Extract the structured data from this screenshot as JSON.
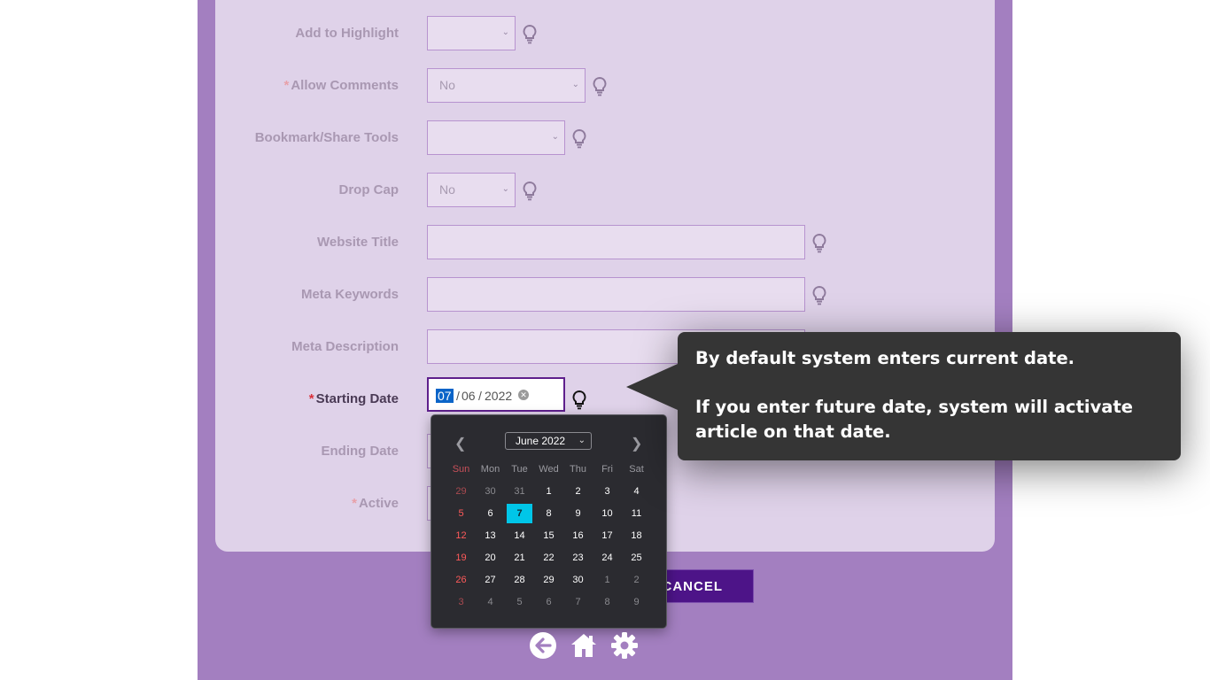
{
  "form": {
    "fields": [
      {
        "label": "Add to Highlight",
        "required": false,
        "value": ""
      },
      {
        "label": "Allow Comments",
        "required": true,
        "value": "No"
      },
      {
        "label": "Bookmark/Share Tools",
        "required": false,
        "value": ""
      },
      {
        "label": "Drop Cap",
        "required": false,
        "value": "No"
      },
      {
        "label": "Website Title",
        "required": false,
        "value": ""
      },
      {
        "label": "Meta Keywords",
        "required": false,
        "value": ""
      },
      {
        "label": "Meta Description",
        "required": false,
        "value": ""
      },
      {
        "label": "Starting Date",
        "required": true,
        "value": "07/06/2022"
      },
      {
        "label": "Ending Date",
        "required": false,
        "value": ""
      },
      {
        "label": "Active",
        "required": true,
        "value": ""
      }
    ],
    "required_mark": "*",
    "date_parts": {
      "day": "07",
      "month": "06",
      "year": "2022",
      "sep": "/"
    }
  },
  "calendar": {
    "month_label": "June 2022",
    "weekdays": [
      "Sun",
      "Mon",
      "Tue",
      "Wed",
      "Thu",
      "Fri",
      "Sat"
    ],
    "weeks": [
      [
        "29",
        "30",
        "31",
        "1",
        "2",
        "3",
        "4"
      ],
      [
        "5",
        "6",
        "7",
        "8",
        "9",
        "10",
        "11"
      ],
      [
        "12",
        "13",
        "14",
        "15",
        "16",
        "17",
        "18"
      ],
      [
        "19",
        "20",
        "21",
        "22",
        "23",
        "24",
        "25"
      ],
      [
        "26",
        "27",
        "28",
        "29",
        "30",
        "1",
        "2"
      ],
      [
        "3",
        "4",
        "5",
        "6",
        "7",
        "8",
        "9"
      ]
    ],
    "selected_day": "7"
  },
  "buttons": {
    "cancel": "CANCEL"
  },
  "tooltip": {
    "line1": "By default system enters current date.",
    "line2": "If you enter future date, system will activate article on that date."
  },
  "icons": {
    "back": "arrow-left-circle-icon",
    "home": "home-icon",
    "settings": "gear-icon",
    "hint": "lightbulb-icon"
  },
  "colors": {
    "page_bg": "#a37fc0",
    "card_bg": "#dfd2e9",
    "accent": "#4d1488",
    "today": "#00c6e8",
    "tooltip_bg": "#353535"
  }
}
